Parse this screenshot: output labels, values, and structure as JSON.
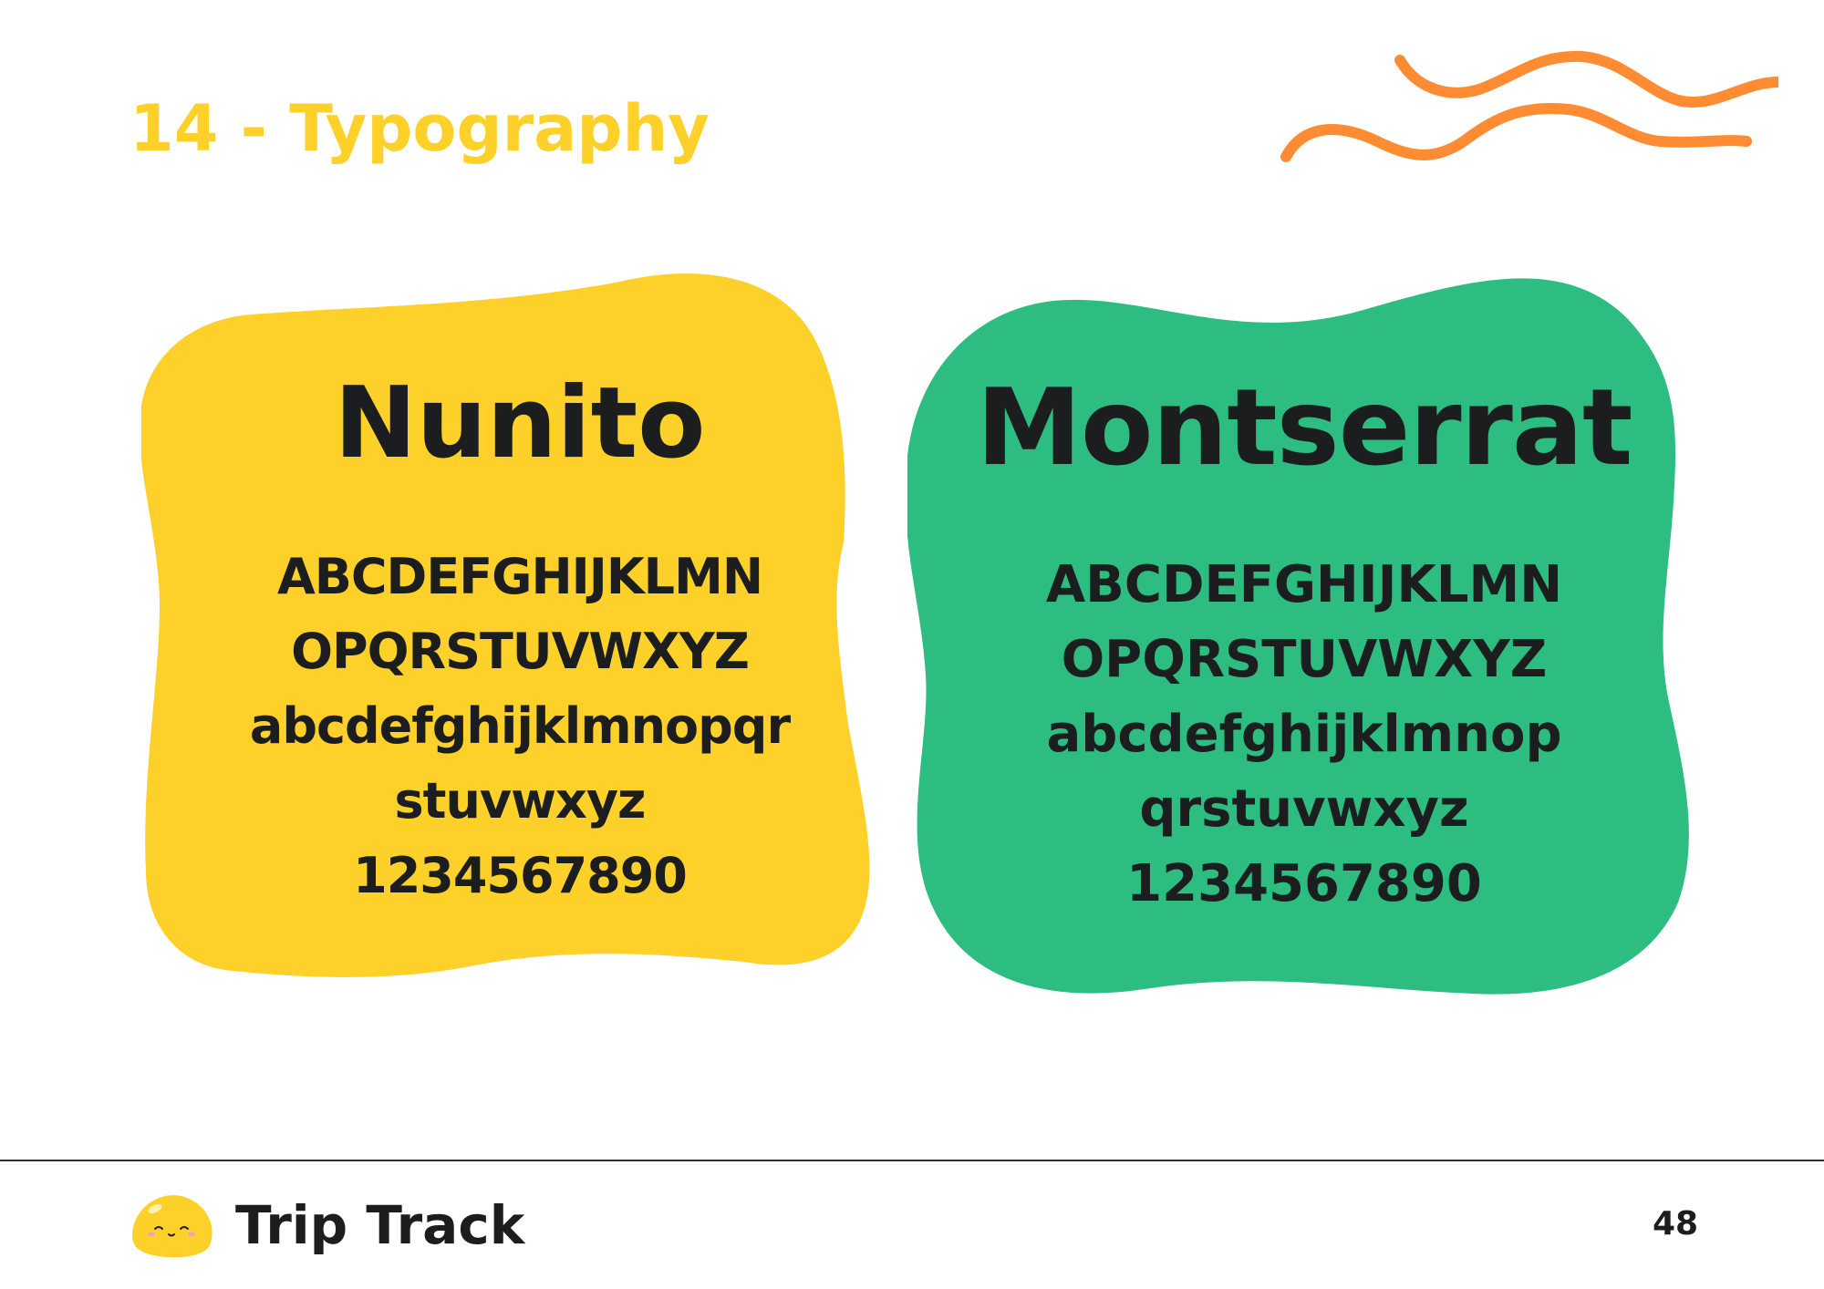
{
  "header": {
    "title": "14 - Typography"
  },
  "colors": {
    "title": "#fdd02a",
    "yellow_blob": "#fdd02a",
    "green_blob": "#2dbd81",
    "squiggle": "#ff8b33",
    "text": "#1b1d1e"
  },
  "fonts": [
    {
      "name": "Nunito",
      "lines": [
        "ABCDEFGHIJKLMN",
        "OPQRSTUVWXYZ",
        "abcdefghijklmnopqr",
        "stuvwxyz",
        "1234567890"
      ]
    },
    {
      "name": "Montserrat",
      "lines": [
        "ABCDEFGHIJKLMN",
        "OPQRSTUVWXYZ",
        "abcdefghijklmnop",
        "qrstuvwxyz",
        "1234567890"
      ]
    }
  ],
  "footer": {
    "brand": "Trip Track",
    "page_number": "48"
  }
}
